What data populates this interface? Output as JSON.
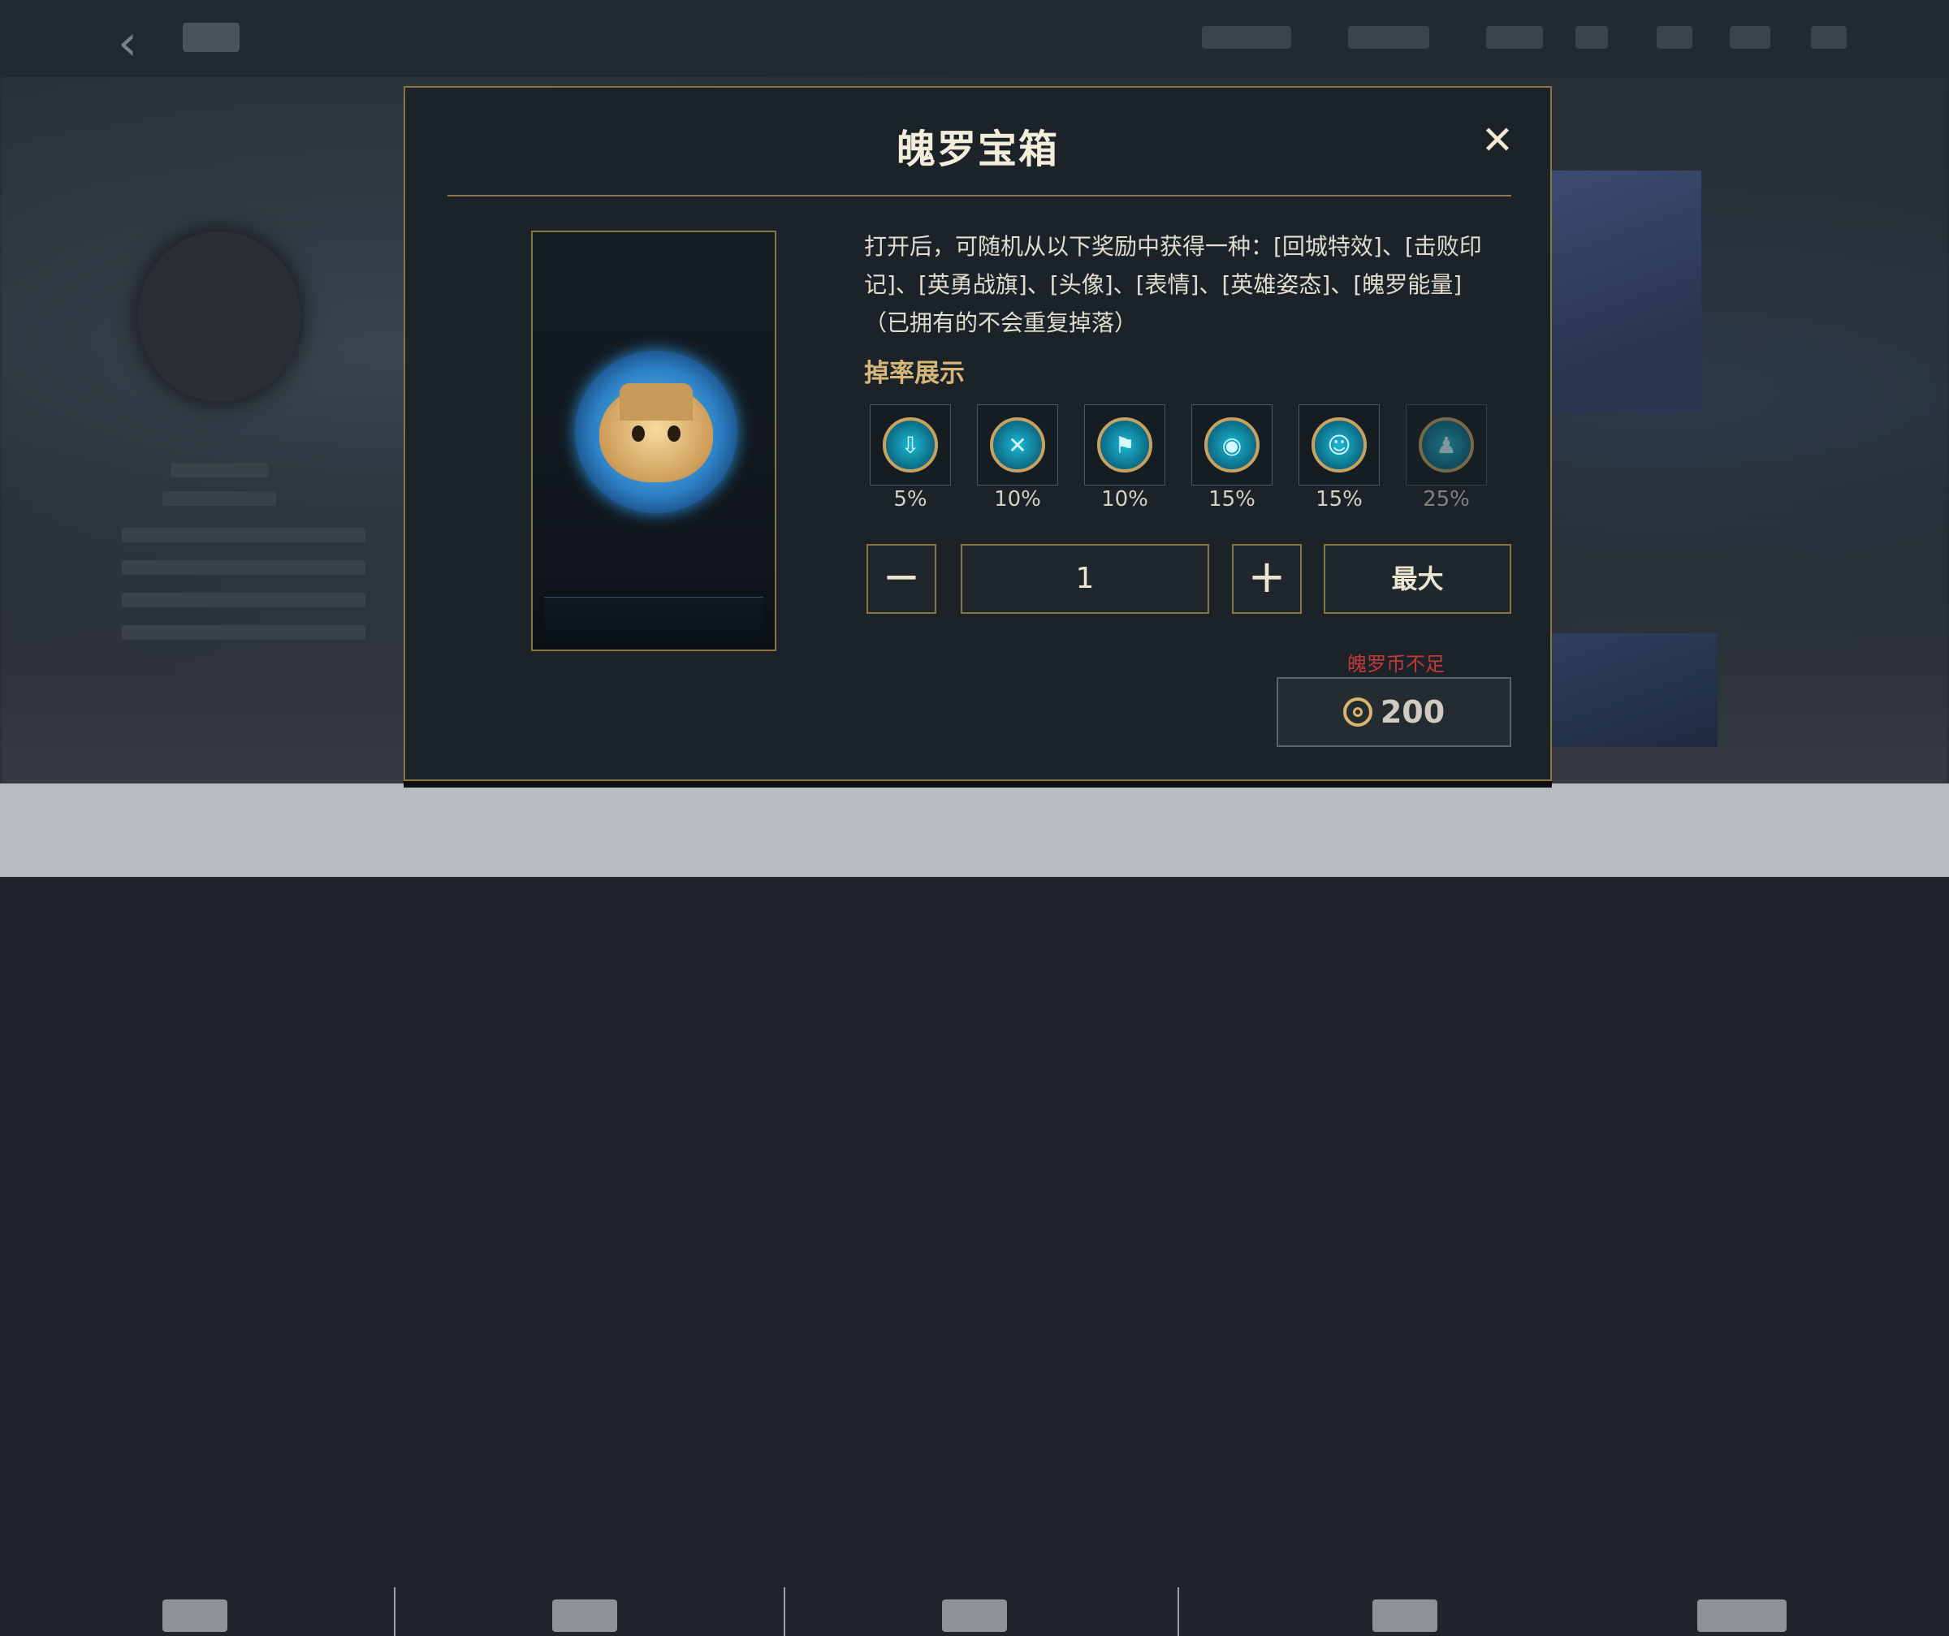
{
  "dialog": {
    "title": "魄罗宝箱",
    "close_symbol": "✕",
    "description": "打开后，可随机从以下奖励中获得一种：[回城特效]、[击败印记]、[英勇战旗]、[头像]、[表情]、[英雄姿态]、[魄罗能量]（已拥有的不会重复掉落）",
    "rate_title": "掉率展示",
    "rates": [
      {
        "icon": "recall-effect-icon",
        "glyph": "⇩",
        "percent": "5%"
      },
      {
        "icon": "defeat-mark-icon",
        "glyph": "✕",
        "percent": "10%"
      },
      {
        "icon": "banner-icon",
        "glyph": "⚑",
        "percent": "10%"
      },
      {
        "icon": "avatar-icon",
        "glyph": "◉",
        "percent": "15%"
      },
      {
        "icon": "emote-icon",
        "glyph": "☺",
        "percent": "15%"
      },
      {
        "icon": "pose-icon",
        "glyph": "♟",
        "percent": "25%"
      }
    ],
    "quantity": {
      "minus": "−",
      "value": "1",
      "plus": "+",
      "max_label": "最大"
    },
    "insufficient_text": "魄罗币不足",
    "price": "200"
  },
  "colors": {
    "accent_gold": "#8a7440",
    "warning_red": "#c03a3a",
    "icon_teal": "#1ab8d4"
  }
}
